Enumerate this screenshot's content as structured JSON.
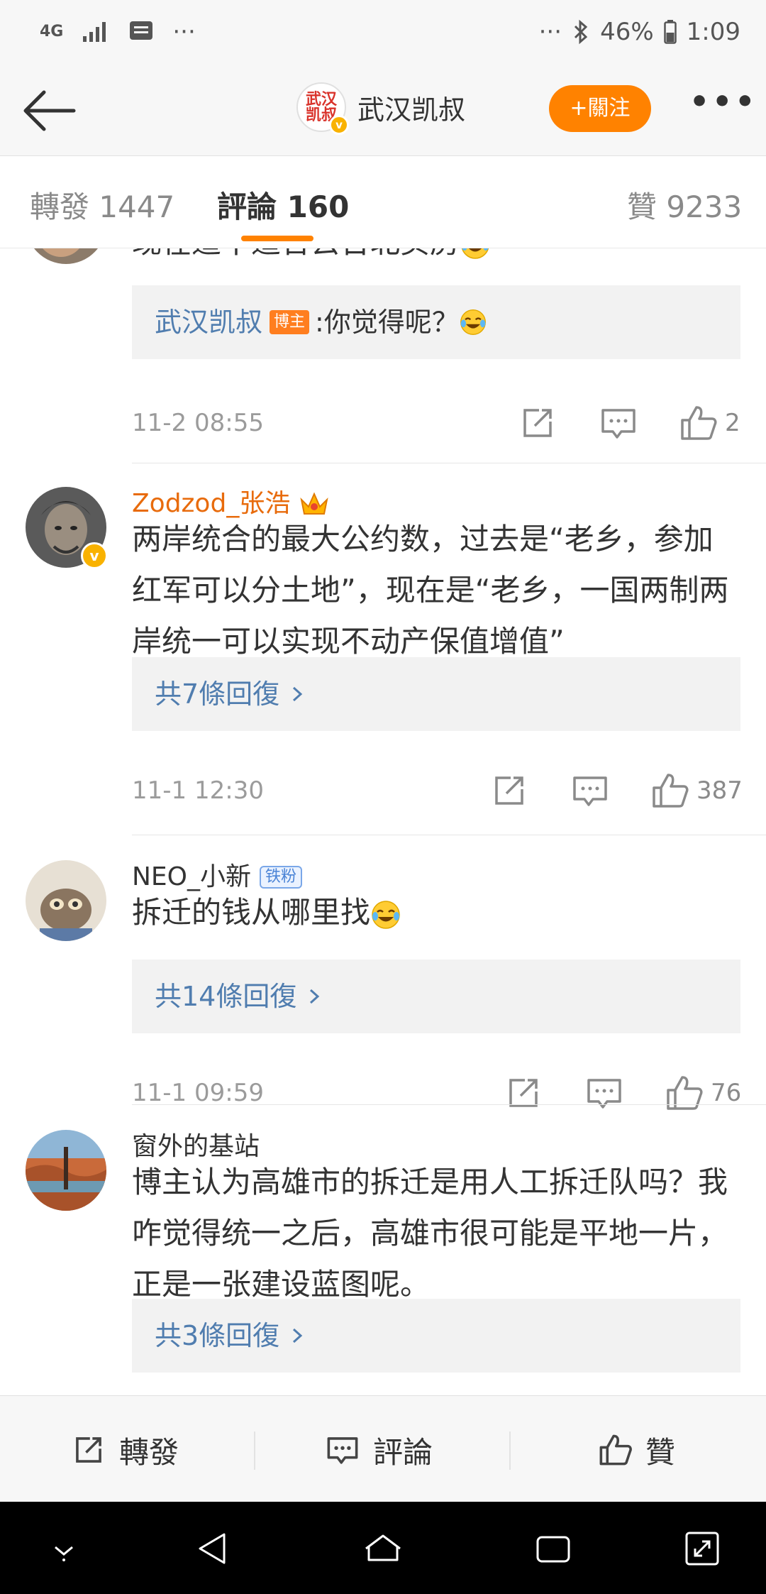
{
  "status_bar": {
    "network": "4G",
    "left_ellipsis": "···",
    "right_ellipsis": "···",
    "battery": "46%",
    "time": "1:09"
  },
  "nav": {
    "author_logo_text": "武汉凯叔",
    "author_name": "武汉凯叔",
    "follow_label": "+關注",
    "more_label": "•••"
  },
  "tabs": {
    "repost": "轉發 1447",
    "comments": "評論 160",
    "likes": "贊 9233"
  },
  "comments": [
    {
      "text": "现在适不适合去台北买房",
      "reply": {
        "author": "武汉凯叔",
        "badge": "博主",
        "text": ":你觉得呢？"
      },
      "time": "11-2 08:55",
      "likes": "2"
    },
    {
      "name": "Zodzod_张浩",
      "text": "两岸统合的最大公约数，过去是“老乡，参加红军可以分土地”，现在是“老乡，一国两制两岸统一可以实现不动产保值增值”",
      "replies_label": "共7條回復",
      "time": "11-1 12:30",
      "likes": "387"
    },
    {
      "name": "NEO_小新",
      "badge": "铁粉",
      "text": "拆迁的钱从哪里找",
      "replies_label": "共14條回復",
      "time": "11-1 09:59",
      "likes": "76"
    },
    {
      "name": "窗外的基站",
      "text": "博主认为高雄市的拆迁是用人工拆迁队吗？我咋觉得统一之后，高雄市很可能是平地一片，正是一张建设蓝图呢。",
      "replies_label": "共3條回復"
    }
  ],
  "bottom_bar": {
    "repost": "轉發",
    "comment": "評論",
    "like": "贊"
  },
  "colors": {
    "accent": "#ff8200",
    "link": "#507daf",
    "vip_name": "#e86b0c"
  }
}
